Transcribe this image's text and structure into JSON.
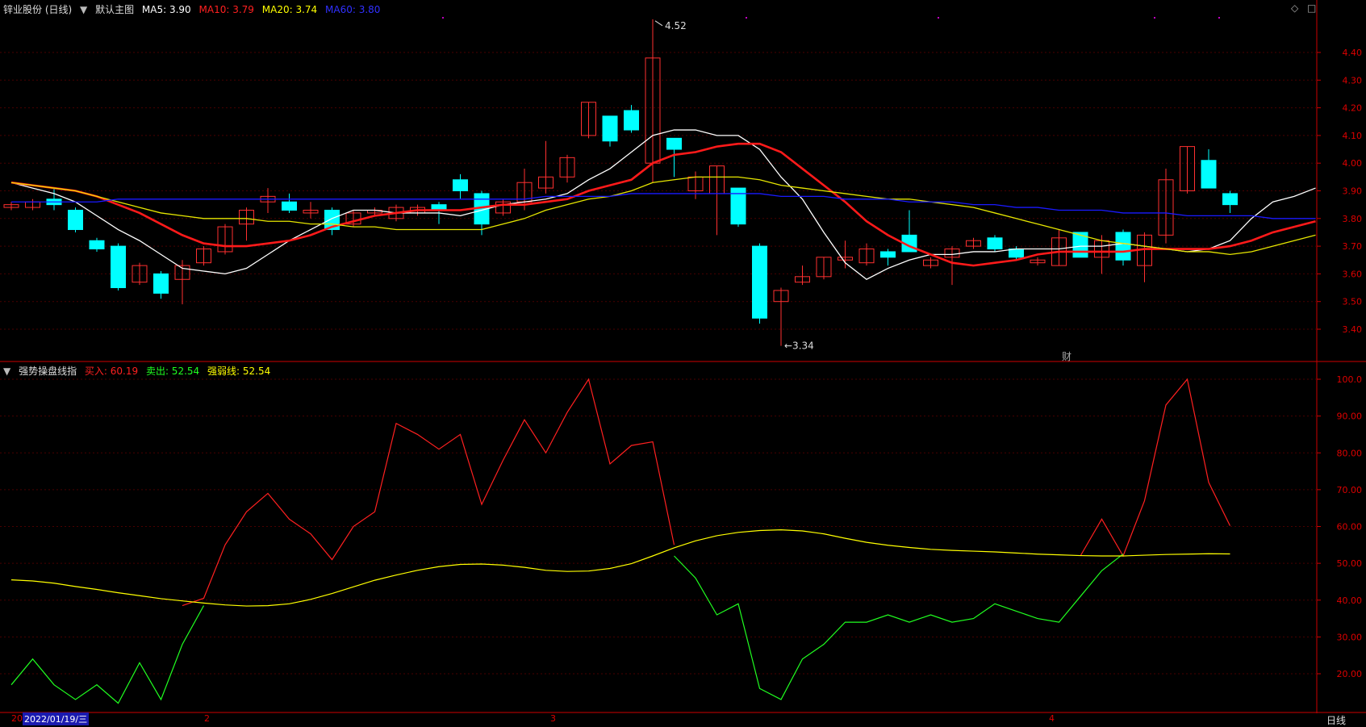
{
  "header": {
    "stock": "锌业股份 (日线)",
    "template": "默认主图",
    "ma": [
      {
        "label": "MA5: 3.90",
        "color": "#ffffff"
      },
      {
        "label": "MA10: 3.79",
        "color": "#ff2020"
      },
      {
        "label": "MA20: 3.74",
        "color": "#ffff00"
      },
      {
        "label": "MA60: 3.80",
        "color": "#2020ff"
      }
    ]
  },
  "indicator_header": {
    "name": "强势操盘线指",
    "buy": {
      "label": "买入: 60.19",
      "color": "#ff2020"
    },
    "sell": {
      "label": "卖出: 52.54",
      "color": "#20ff20"
    },
    "strength": {
      "label": "强弱线: 52.54",
      "color": "#ffff00"
    }
  },
  "annotations": {
    "high_label": "4.52",
    "low_label": "3.34",
    "event_marker": "财"
  },
  "footer": {
    "date_prefix": "20",
    "date": "2022/01/19/三",
    "month_labels": [
      "2",
      "3",
      "4"
    ],
    "period": "日线"
  },
  "colors": {
    "up": "#ff3030",
    "down": "#00ffff",
    "axis": "#cc0000",
    "grid": "#4a0000"
  },
  "chart_data": [
    {
      "type": "candlestick",
      "title": "锌业股份 (日线)",
      "ylim": [
        3.34,
        4.52
      ],
      "yticks": [
        "4.40",
        "4.30",
        "4.20",
        "4.10",
        "4.00",
        "3.90",
        "3.80",
        "3.70",
        "3.60",
        "3.50",
        "3.40"
      ],
      "ohlc": [
        [
          3.84,
          3.86,
          3.83,
          3.85
        ],
        [
          3.84,
          3.87,
          3.83,
          3.86
        ],
        [
          3.87,
          3.91,
          3.83,
          3.85
        ],
        [
          3.83,
          3.84,
          3.75,
          3.76
        ],
        [
          3.72,
          3.73,
          3.68,
          3.69
        ],
        [
          3.7,
          3.71,
          3.54,
          3.55
        ],
        [
          3.57,
          3.64,
          3.56,
          3.63
        ],
        [
          3.6,
          3.61,
          3.51,
          3.53
        ],
        [
          3.58,
          3.65,
          3.49,
          3.63
        ],
        [
          3.64,
          3.7,
          3.63,
          3.69
        ],
        [
          3.68,
          3.78,
          3.67,
          3.77
        ],
        [
          3.78,
          3.84,
          3.72,
          3.83
        ],
        [
          3.86,
          3.91,
          3.82,
          3.88
        ],
        [
          3.86,
          3.89,
          3.82,
          3.83
        ],
        [
          3.82,
          3.86,
          3.8,
          3.83
        ],
        [
          3.83,
          3.84,
          3.74,
          3.76
        ],
        [
          3.78,
          3.83,
          3.77,
          3.82
        ],
        [
          3.82,
          3.84,
          3.81,
          3.83
        ],
        [
          3.8,
          3.85,
          3.79,
          3.84
        ],
        [
          3.82,
          3.85,
          3.81,
          3.84
        ],
        [
          3.85,
          3.86,
          3.78,
          3.83
        ],
        [
          3.94,
          3.96,
          3.87,
          3.9
        ],
        [
          3.89,
          3.9,
          3.74,
          3.78
        ],
        [
          3.82,
          3.87,
          3.81,
          3.86
        ],
        [
          3.86,
          3.98,
          3.83,
          3.93
        ],
        [
          3.91,
          4.08,
          3.89,
          3.95
        ],
        [
          3.95,
          4.03,
          3.93,
          4.02
        ],
        [
          4.1,
          4.22,
          4.09,
          4.22
        ],
        [
          4.17,
          4.17,
          4.06,
          4.08
        ],
        [
          4.19,
          4.21,
          4.11,
          4.12
        ],
        [
          4.0,
          4.52,
          3.93,
          4.38
        ],
        [
          4.09,
          4.09,
          3.95,
          4.05
        ],
        [
          3.9,
          3.97,
          3.87,
          3.95
        ],
        [
          3.89,
          3.99,
          3.74,
          3.99
        ],
        [
          3.91,
          3.91,
          3.77,
          3.78
        ],
        [
          3.7,
          3.71,
          3.42,
          3.44
        ],
        [
          3.5,
          3.55,
          3.34,
          3.54
        ],
        [
          3.57,
          3.63,
          3.56,
          3.59
        ],
        [
          3.59,
          3.66,
          3.58,
          3.66
        ],
        [
          3.65,
          3.72,
          3.62,
          3.66
        ],
        [
          3.64,
          3.71,
          3.63,
          3.69
        ],
        [
          3.68,
          3.69,
          3.63,
          3.66
        ],
        [
          3.74,
          3.83,
          3.69,
          3.68
        ],
        [
          3.63,
          3.66,
          3.62,
          3.65
        ],
        [
          3.66,
          3.7,
          3.56,
          3.69
        ],
        [
          3.7,
          3.73,
          3.69,
          3.72
        ],
        [
          3.73,
          3.74,
          3.68,
          3.69
        ],
        [
          3.69,
          3.7,
          3.65,
          3.66
        ],
        [
          3.64,
          3.66,
          3.63,
          3.65
        ],
        [
          3.63,
          3.76,
          3.63,
          3.73
        ],
        [
          3.75,
          3.75,
          3.66,
          3.66
        ],
        [
          3.66,
          3.74,
          3.6,
          3.72
        ],
        [
          3.75,
          3.76,
          3.63,
          3.65
        ],
        [
          3.63,
          3.75,
          3.57,
          3.74
        ],
        [
          3.74,
          3.98,
          3.71,
          3.94
        ],
        [
          3.9,
          4.06,
          3.89,
          4.06
        ],
        [
          4.01,
          4.05,
          3.91,
          3.91
        ],
        [
          3.89,
          3.9,
          3.82,
          3.85
        ]
      ],
      "series": [
        {
          "name": "MA5",
          "values": [
            3.93,
            3.91,
            3.89,
            3.86,
            3.81,
            3.76,
            3.72,
            3.67,
            3.62,
            3.61,
            3.6,
            3.62,
            3.67,
            3.72,
            3.76,
            3.8,
            3.83,
            3.83,
            3.82,
            3.82,
            3.82,
            3.81,
            3.83,
            3.85,
            3.86,
            3.87,
            3.89,
            3.94,
            3.98,
            4.04,
            4.1,
            4.12,
            4.12,
            4.1,
            4.1,
            4.05,
            3.95,
            3.87,
            3.75,
            3.64,
            3.58,
            3.62,
            3.65,
            3.67,
            3.67,
            3.68,
            3.68,
            3.69,
            3.69,
            3.69,
            3.7,
            3.7,
            3.71,
            3.7,
            3.69,
            3.68,
            3.69,
            3.72,
            3.8,
            3.86,
            3.88,
            3.91
          ]
        },
        {
          "name": "MA10",
          "values": [
            3.93,
            3.92,
            3.91,
            3.9,
            3.88,
            3.85,
            3.82,
            3.78,
            3.74,
            3.71,
            3.7,
            3.7,
            3.71,
            3.72,
            3.74,
            3.77,
            3.79,
            3.81,
            3.82,
            3.83,
            3.83,
            3.83,
            3.84,
            3.85,
            3.85,
            3.86,
            3.87,
            3.9,
            3.92,
            3.94,
            4.0,
            4.03,
            4.04,
            4.06,
            4.07,
            4.07,
            4.04,
            3.98,
            3.92,
            3.86,
            3.79,
            3.74,
            3.7,
            3.67,
            3.64,
            3.63,
            3.64,
            3.65,
            3.67,
            3.68,
            3.68,
            3.68,
            3.68,
            3.69,
            3.69,
            3.69,
            3.69,
            3.7,
            3.72,
            3.75,
            3.77,
            3.79
          ]
        },
        {
          "name": "MA20",
          "values": [
            3.93,
            3.92,
            3.91,
            3.9,
            3.88,
            3.86,
            3.84,
            3.82,
            3.81,
            3.8,
            3.8,
            3.8,
            3.79,
            3.79,
            3.78,
            3.78,
            3.77,
            3.77,
            3.76,
            3.76,
            3.76,
            3.76,
            3.76,
            3.78,
            3.8,
            3.83,
            3.85,
            3.87,
            3.88,
            3.9,
            3.93,
            3.94,
            3.95,
            3.95,
            3.95,
            3.94,
            3.92,
            3.91,
            3.9,
            3.89,
            3.88,
            3.87,
            3.87,
            3.86,
            3.85,
            3.84,
            3.82,
            3.8,
            3.78,
            3.76,
            3.74,
            3.72,
            3.71,
            3.7,
            3.69,
            3.68,
            3.68,
            3.67,
            3.68,
            3.7,
            3.72,
            3.74
          ]
        },
        {
          "name": "MA60",
          "values": [
            3.86,
            3.86,
            3.86,
            3.86,
            3.86,
            3.87,
            3.87,
            3.87,
            3.87,
            3.87,
            3.87,
            3.87,
            3.87,
            3.87,
            3.87,
            3.87,
            3.87,
            3.87,
            3.87,
            3.87,
            3.87,
            3.87,
            3.87,
            3.87,
            3.87,
            3.88,
            3.88,
            3.88,
            3.88,
            3.89,
            3.89,
            3.89,
            3.89,
            3.89,
            3.89,
            3.89,
            3.88,
            3.88,
            3.88,
            3.87,
            3.87,
            3.87,
            3.86,
            3.86,
            3.86,
            3.85,
            3.85,
            3.84,
            3.84,
            3.83,
            3.83,
            3.83,
            3.82,
            3.82,
            3.82,
            3.81,
            3.81,
            3.81,
            3.81,
            3.8,
            3.8,
            3.8
          ]
        }
      ]
    },
    {
      "type": "line",
      "title": "强势操盘线指",
      "ylim": [
        12,
        100
      ],
      "yticks": [
        "100.0",
        "90.00",
        "80.00",
        "70.00",
        "60.00",
        "50.00",
        "40.00",
        "30.00",
        "20.00"
      ],
      "series": [
        {
          "name": "买入",
          "color": "#ff2020",
          "values": [
            null,
            null,
            null,
            null,
            null,
            null,
            null,
            null,
            38.5,
            40.5,
            55,
            64,
            69,
            62,
            58,
            51,
            60,
            64,
            88,
            85,
            81,
            85,
            66,
            78,
            89,
            80,
            91,
            100,
            77,
            82,
            83,
            55,
            null,
            null,
            null,
            null,
            null,
            null,
            null,
            null,
            null,
            null,
            null,
            null,
            null,
            null,
            null,
            null,
            null,
            null,
            52,
            62,
            52,
            67,
            93,
            100,
            72,
            60.19
          ]
        },
        {
          "name": "卖出",
          "color": "#20ff20",
          "values": [
            17,
            24,
            17,
            13,
            17,
            12,
            23,
            13,
            28,
            38.5,
            null,
            null,
            null,
            null,
            null,
            null,
            null,
            null,
            null,
            null,
            null,
            null,
            null,
            null,
            null,
            null,
            null,
            null,
            null,
            null,
            null,
            52,
            46,
            36,
            39,
            16,
            13,
            24,
            28,
            34,
            34,
            36,
            34,
            36,
            34,
            35,
            39,
            37,
            35,
            34,
            41,
            48,
            52.54,
            null,
            null,
            null,
            null,
            null
          ]
        },
        {
          "name": "强弱线",
          "color": "#ffff00",
          "values": [
            45.5,
            45.2,
            44.6,
            43.7,
            42.9,
            42.0,
            41.2,
            40.4,
            39.8,
            39.2,
            38.7,
            38.4,
            38.5,
            39.0,
            40.2,
            41.8,
            43.6,
            45.4,
            46.8,
            48.1,
            49.1,
            49.7,
            49.8,
            49.5,
            48.9,
            48.1,
            47.8,
            47.9,
            48.6,
            49.9,
            52.0,
            54.2,
            56.1,
            57.5,
            58.4,
            58.9,
            59.1,
            58.8,
            58.0,
            56.8,
            55.7,
            54.9,
            54.3,
            53.8,
            53.5,
            53.3,
            53.1,
            52.8,
            52.5,
            52.3,
            52.1,
            52.0,
            52.0,
            52.2,
            52.4,
            52.5,
            52.6,
            52.54
          ]
        }
      ]
    }
  ]
}
